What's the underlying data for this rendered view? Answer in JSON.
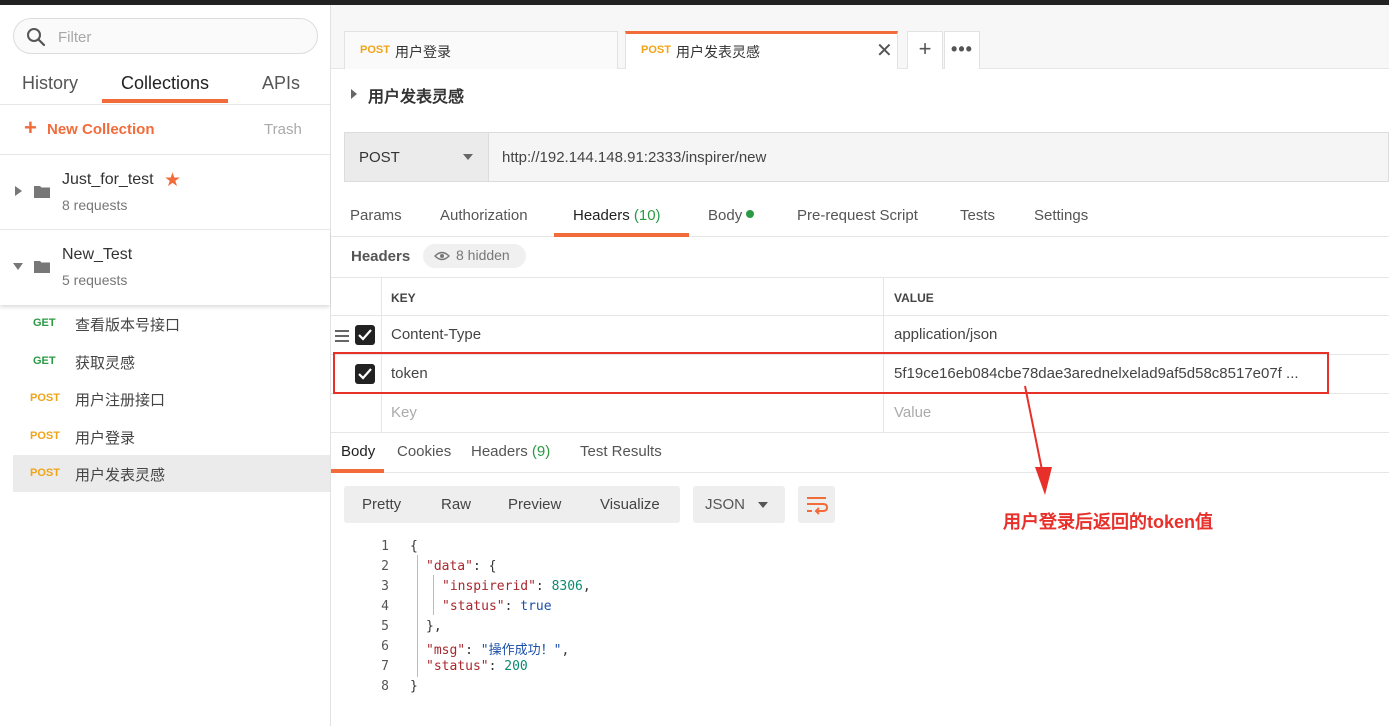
{
  "sidebar": {
    "filter_placeholder": "Filter",
    "tabs": [
      {
        "label": "History"
      },
      {
        "label": "Collections"
      },
      {
        "label": "APIs"
      }
    ],
    "new_collection": "New Collection",
    "trash": "Trash",
    "collections": [
      {
        "name": "Just_for_test",
        "count": "8 requests",
        "starred": true,
        "expanded": false
      },
      {
        "name": "New_Test",
        "count": "5 requests",
        "starred": false,
        "expanded": true
      }
    ],
    "requests": [
      {
        "method": "GET",
        "name": "查看版本号接口"
      },
      {
        "method": "GET",
        "name": "获取灵感"
      },
      {
        "method": "POST",
        "name": "用户注册接口"
      },
      {
        "method": "POST",
        "name": "用户登录"
      },
      {
        "method": "POST",
        "name": "用户发表灵感",
        "active": true
      }
    ]
  },
  "tabs": [
    {
      "method": "POST",
      "name": "用户登录"
    },
    {
      "method": "POST",
      "name": "用户发表灵感",
      "active": true
    }
  ],
  "request": {
    "title": "用户发表灵感",
    "method": "POST",
    "url": "http://192.144.148.91:2333/inspirer/new",
    "subtabs": {
      "params": "Params",
      "authorization": "Authorization",
      "headers": "Headers",
      "headers_count": "(10)",
      "body": "Body",
      "prerequest": "Pre-request Script",
      "tests": "Tests",
      "settings": "Settings"
    },
    "headers_label": "Headers",
    "hidden_badge": "8 hidden",
    "table": {
      "key_col": "KEY",
      "value_col": "VALUE",
      "rows": [
        {
          "key": "Content-Type",
          "value": "application/json",
          "checked": true
        },
        {
          "key": "token",
          "value": "5f19ce16eb084cbe78dae3arednelxelad9af5d58c8517e07f ...",
          "checked": true
        }
      ],
      "key_placeholder": "Key",
      "value_placeholder": "Value"
    }
  },
  "response": {
    "tabs": {
      "body": "Body",
      "cookies": "Cookies",
      "headers": "Headers",
      "headers_count": "(9)",
      "test_results": "Test Results"
    },
    "views": [
      "Pretty",
      "Raw",
      "Preview",
      "Visualize"
    ],
    "format": "JSON",
    "line_numbers": [
      "1",
      "2",
      "3",
      "4",
      "5",
      "6",
      "7",
      "8"
    ],
    "json": {
      "data_key": "\"data\"",
      "inspirerid_key": "\"inspirerid\"",
      "inspirerid_val": "8306",
      "status_key": "\"status\"",
      "status_true": "true",
      "msg_key": "\"msg\"",
      "msg_val": "\"操作成功！\"",
      "status_val": "200"
    }
  },
  "annotation": "用户登录后返回的token值",
  "colors": {
    "accent": "#f26b3a",
    "annotation": "#e8302b",
    "get": "#2a9a44",
    "post": "#f0a418"
  }
}
